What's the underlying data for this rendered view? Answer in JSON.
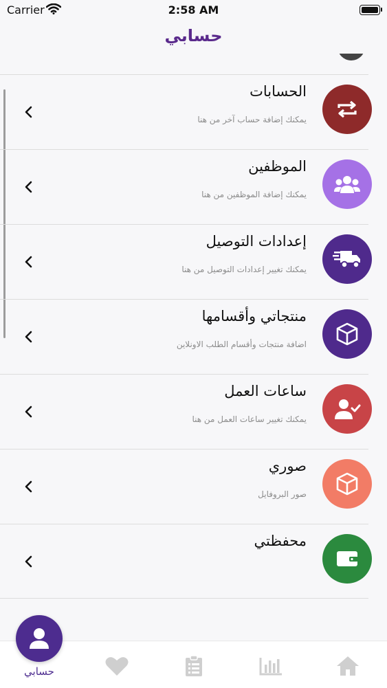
{
  "status_bar": {
    "carrier": "Carrier",
    "time": "2:58 AM"
  },
  "header": {
    "title": "حسابي"
  },
  "menu": {
    "items": [
      {
        "title": "الحسابات",
        "subtitle": "يمكنك إضافة حساب آخر من هنا",
        "icon": "repeat-icon",
        "color": "#8e2a2a"
      },
      {
        "title": "الموظفين",
        "subtitle": "يمكنك إضافة الموظفين من هنا",
        "icon": "users-icon",
        "color": "#a571e6"
      },
      {
        "title": "إعدادات التوصيل",
        "subtitle": "يمكنك تغيير إعدادات التوصيل من هنا",
        "icon": "delivery-truck-icon",
        "color": "#4f2a8c"
      },
      {
        "title": "منتجاتي وأقسامها",
        "subtitle": "اضافة منتجات وأقسام الطلب الاونلاين",
        "icon": "box-icon",
        "color": "#4f2a8c"
      },
      {
        "title": "ساعات العمل",
        "subtitle": "يمكنك تغيير ساعات العمل من هنا",
        "icon": "user-check-icon",
        "color": "#c84447"
      },
      {
        "title": "صوري",
        "subtitle": "صور البروفايل",
        "icon": "box-icon",
        "color": "#f27c66"
      },
      {
        "title": "محفظتي",
        "subtitle": "",
        "icon": "wallet-icon",
        "color": "#2b8a3e"
      }
    ]
  },
  "tabbar": {
    "active_label": "حسابي",
    "active_icon": "user-icon",
    "tabs": [
      "heart-icon",
      "clipboard-list-icon",
      "bar-chart-icon",
      "home-icon"
    ],
    "active_color": "#4d2c8f",
    "inactive_color": "#cfcfcf"
  }
}
